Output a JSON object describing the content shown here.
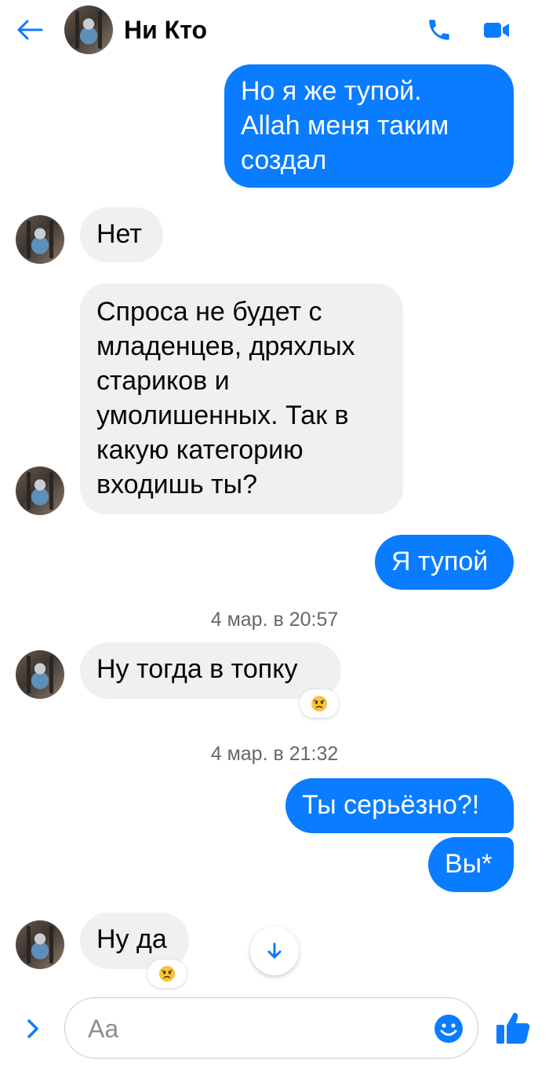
{
  "header": {
    "back_icon": "arrow-left-icon",
    "contact_name": "Ни Кто",
    "call_icon": "phone-icon",
    "video_icon": "video-camera-icon",
    "accent_color": "#0a7cff"
  },
  "messages": [
    {
      "id": "m1",
      "direction": "outgoing",
      "lines": [
        "Но я же тупой.",
        "Allaһ меня таким",
        "создал"
      ]
    },
    {
      "id": "m2",
      "direction": "incoming",
      "text": "Нет"
    },
    {
      "id": "m3",
      "direction": "incoming",
      "lines": [
        "Спроса не будет с",
        "младенцев, дряхлых",
        "стариков и",
        "умолишенных. Так в",
        "какую категорию",
        "входишь ты?"
      ]
    },
    {
      "id": "m4",
      "direction": "outgoing",
      "text": "Я тупой"
    },
    {
      "id": "m5",
      "direction": "incoming",
      "text": "Ну тогда в топку",
      "reaction": "angry-face"
    },
    {
      "id": "m6",
      "direction": "outgoing",
      "text": "Ты серьёзно?!"
    },
    {
      "id": "m7",
      "direction": "outgoing",
      "text": "Вы*"
    },
    {
      "id": "m8",
      "direction": "incoming",
      "text": "Ну да",
      "reaction": "angry-face"
    }
  ],
  "timestamps": [
    "4 мар. в 20:57",
    "4 мар. в 21:32"
  ],
  "composer": {
    "placeholder": "Aa",
    "expand_icon": "chevron-right-icon",
    "emoji_icon": "smiley-icon",
    "like_icon": "thumbs-up-icon"
  },
  "scroll_down_icon": "arrow-down-icon",
  "colors": {
    "outgoing_bubble": "#0a7cff",
    "incoming_bubble": "#f0f0f3",
    "timestamp_text": "#65676b"
  }
}
